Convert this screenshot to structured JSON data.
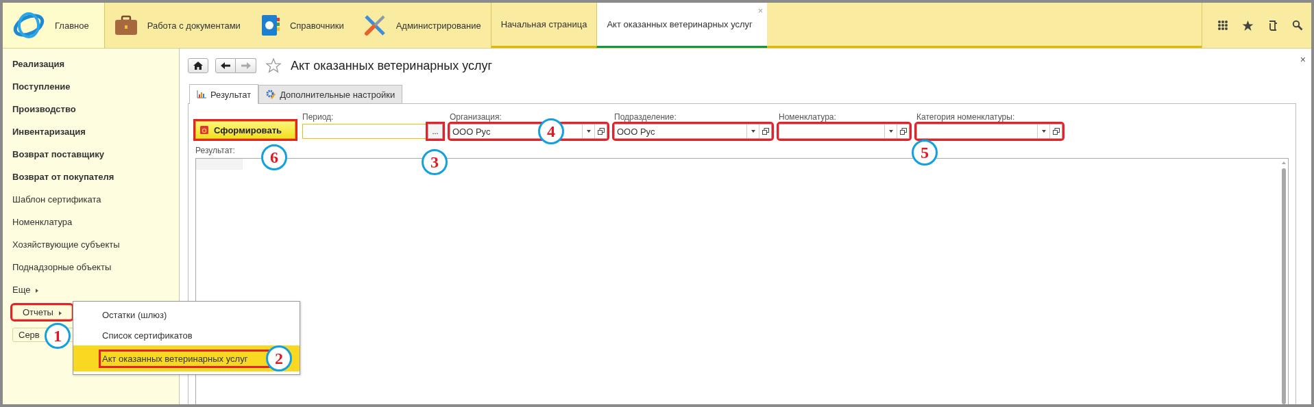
{
  "section_bar": {
    "sections": [
      {
        "label": "Главное",
        "kind": "home",
        "selected": true
      },
      {
        "label": "Работа с документами",
        "kind": "documents",
        "selected": false
      },
      {
        "label": "Справочники",
        "kind": "catalogs",
        "selected": false
      },
      {
        "label": "Администрирование",
        "kind": "admin",
        "selected": false
      }
    ],
    "open_tabs": [
      {
        "label": "Начальная страница",
        "selected": false
      },
      {
        "label": "Акт оказанных ветеринарных услуг",
        "selected": true,
        "close_glyph": "×"
      }
    ]
  },
  "sidebar": {
    "items": [
      {
        "label": "Реализация",
        "kind": "group"
      },
      {
        "label": "Поступление",
        "kind": "group"
      },
      {
        "label": "Производство",
        "kind": "group"
      },
      {
        "label": "Инвентаризация",
        "kind": "group"
      },
      {
        "label": "Возврат поставщику",
        "kind": "group"
      },
      {
        "label": "Возврат от покупателя",
        "kind": "group"
      },
      {
        "label": "Шаблон сертификата",
        "kind": "link"
      },
      {
        "label": "Номенклатура",
        "kind": "link"
      },
      {
        "label": "Хозяйствующие субъекты",
        "kind": "link"
      },
      {
        "label": "Поднадзорные объекты",
        "kind": "link"
      },
      {
        "label": "Еще",
        "kind": "more"
      },
      {
        "label": "Отчеты",
        "kind": "button",
        "highlighted": true,
        "callout": "1",
        "submenu": {
          "items": [
            {
              "label": "Остатки (шлюз)",
              "selected": false,
              "highlighted": false
            },
            {
              "label": "Список сертификатов",
              "selected": false,
              "highlighted": false
            },
            {
              "label": "Акт оказанных ветеринарных услуг",
              "selected": true,
              "highlighted": true,
              "callout": "2"
            }
          ]
        }
      },
      {
        "label": "Серв",
        "kind": "button",
        "highlighted": false
      }
    ]
  },
  "form": {
    "title": "Акт оказанных ветеринарных услуг",
    "favorite": false,
    "close_glyph": "×",
    "tabs": [
      {
        "label": "Результат",
        "kind": "result",
        "selected": true
      },
      {
        "label": "Дополнительные настройки",
        "kind": "settings",
        "selected": false
      }
    ],
    "generate_button": {
      "label": "Сформировать",
      "highlighted": true,
      "callout": "6"
    },
    "fields": [
      {
        "label": "Период:",
        "kind": "period",
        "select_button": {
          "label": "...",
          "highlighted": true,
          "callout": "3"
        }
      },
      {
        "label": "Организация:",
        "kind": "choice",
        "value": "ООО Рус",
        "highlighted": true,
        "callout": "4"
      },
      {
        "label": "Подразделение:",
        "kind": "choice",
        "value": "ООО Рус",
        "highlighted": true
      },
      {
        "label": "Номенклатура:",
        "kind": "choice",
        "highlighted": true
      },
      {
        "label": "Категория номенклатуры:",
        "kind": "choice",
        "highlighted": true,
        "callout": "5"
      }
    ],
    "result": {
      "label": "Результат:"
    }
  }
}
